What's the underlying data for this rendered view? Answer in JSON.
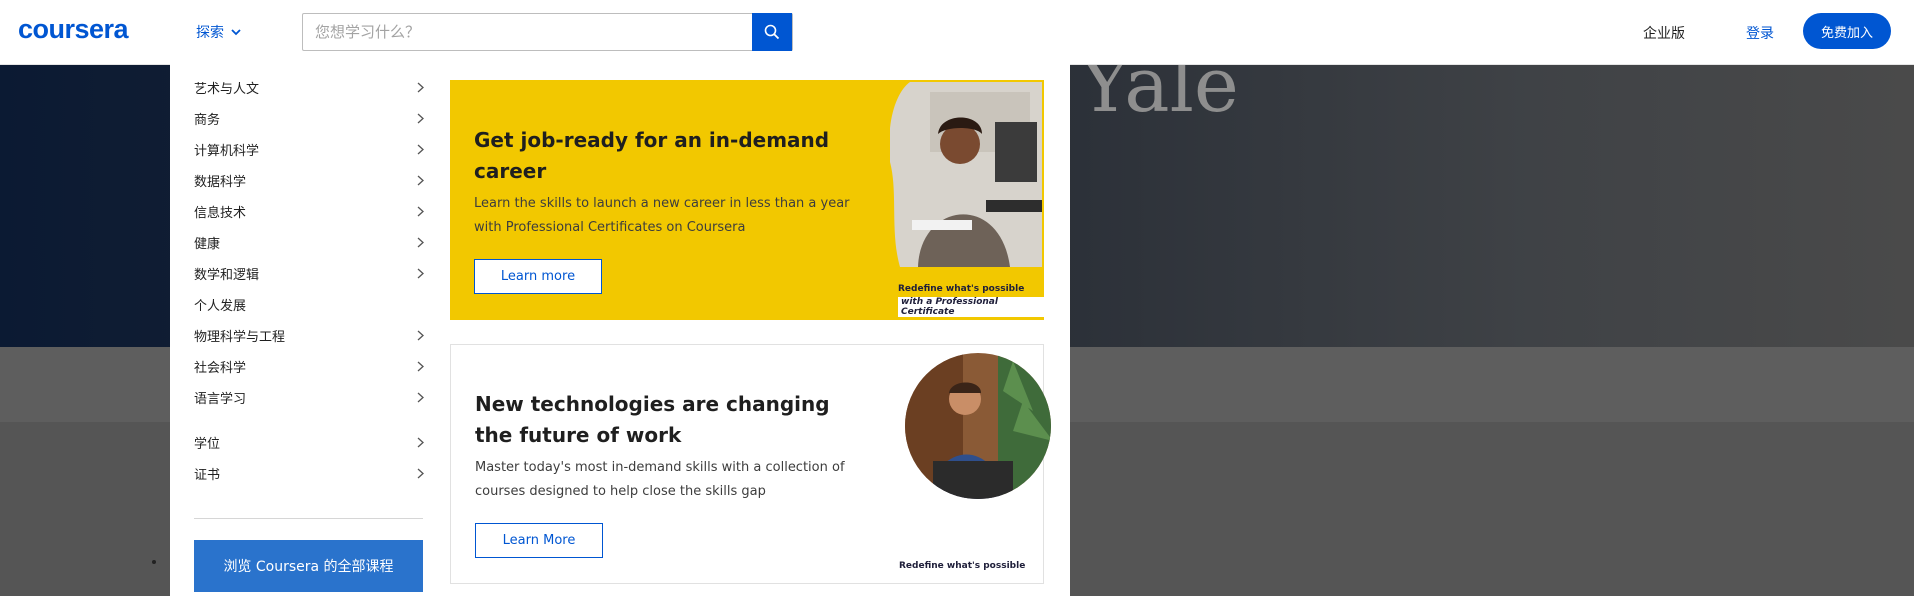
{
  "background": {
    "hero_text": "Yale"
  },
  "nav": {
    "logo": "coursera",
    "explore_label": "探索",
    "search_placeholder": "您想学习什么？",
    "enterprise_label": "企业版",
    "login_label": "登录",
    "join_label": "免费加入"
  },
  "menu": {
    "categories": [
      {
        "label": "艺术与人文",
        "has_submenu": true
      },
      {
        "label": "商务",
        "has_submenu": true
      },
      {
        "label": "计算机科学",
        "has_submenu": true
      },
      {
        "label": "数据科学",
        "has_submenu": true
      },
      {
        "label": "信息技术",
        "has_submenu": true
      },
      {
        "label": "健康",
        "has_submenu": true
      },
      {
        "label": "数学和逻辑",
        "has_submenu": true
      },
      {
        "label": "个人发展",
        "has_submenu": false
      },
      {
        "label": "物理科学与工程",
        "has_submenu": true
      },
      {
        "label": "社会科学",
        "has_submenu": true
      },
      {
        "label": "语言学习",
        "has_submenu": true
      }
    ],
    "programs": [
      {
        "label": "学位",
        "has_submenu": true
      },
      {
        "label": "证书",
        "has_submenu": true
      }
    ],
    "browse_button": "浏览 Coursera 的全部课程"
  },
  "promos": [
    {
      "title": "Get job-ready for an in-demand career",
      "description": "Learn the skills to launch a new career in less than a year with Professional Certificates on Coursera",
      "button": "Learn more",
      "tagline_1": "Redefine what's possible",
      "tagline_2": "with a Professional Certificate",
      "background_color": "#f2c800"
    },
    {
      "title": "New technologies are changing the future of work",
      "description": "Master today's most in-demand skills with a collection of courses designed to help close the skills gap",
      "button": "Learn More",
      "tagline_1": "Redefine what's possible",
      "background_color": "#ffffff"
    }
  ],
  "colors": {
    "brand_blue": "#0056d2",
    "browse_button": "#2a73cc"
  }
}
